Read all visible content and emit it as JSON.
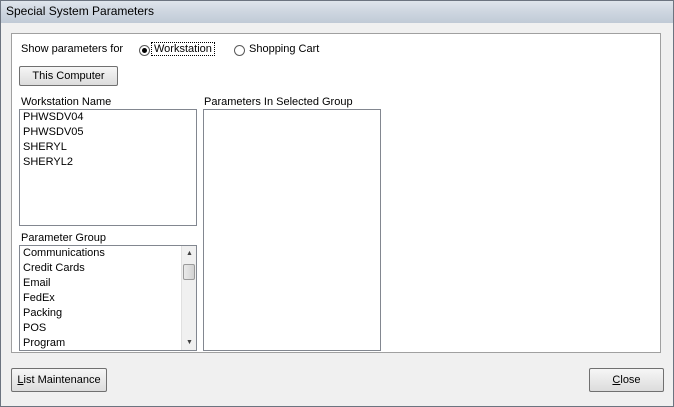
{
  "window": {
    "title": "Special System Parameters"
  },
  "filter": {
    "label": "Show parameters for",
    "options": [
      {
        "label": "Workstation",
        "selected": true
      },
      {
        "label": "Shopping Cart",
        "selected": false
      }
    ]
  },
  "this_computer_button": "This Computer",
  "workstation": {
    "heading": "Workstation Name",
    "items": [
      "PHWSDV04",
      "PHWSDV05",
      "SHERYL",
      "SHERYL2"
    ]
  },
  "parameter_group": {
    "heading": "Parameter Group",
    "items": [
      "Communications",
      "Credit Cards",
      "Email",
      "FedEx",
      "Packing",
      "POS",
      "Program"
    ]
  },
  "parameters_heading": "Parameters In Selected Group",
  "footer": {
    "list_maintenance": {
      "mnemonic": "L",
      "rest": "ist Maintenance"
    },
    "close": {
      "mnemonic": "C",
      "rest": "lose"
    }
  }
}
